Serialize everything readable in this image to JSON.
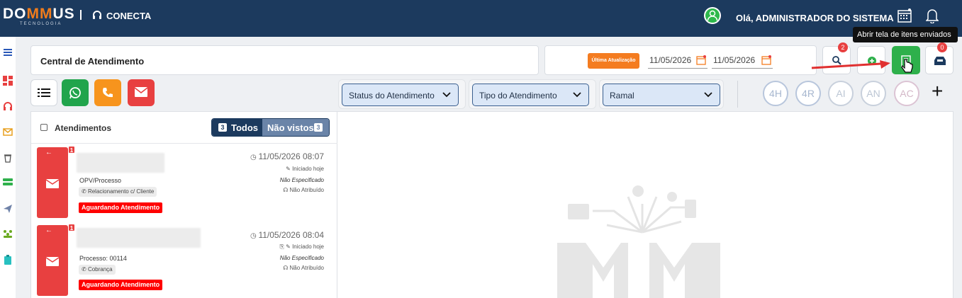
{
  "topbar": {
    "logo_text": "DOMMUS",
    "logo_prefix": "DO",
    "logo_mm": "MM",
    "logo_suffix": "US",
    "logo_sub": "TECNOLOGIA",
    "module": "CONECTA",
    "greeting": "Olá, ADMINISTRADOR DO SISTEMA"
  },
  "tooltip": "Abrir tela de itens enviados",
  "header": {
    "title": "Central de Atendimento",
    "update_badge": "Última Atualização",
    "date_start": "11/05/2026",
    "date_end": "11/05/2026",
    "search_count": "2",
    "inbox_count": "0"
  },
  "filters": {
    "status": "Status do Atendimento",
    "tipo": "Tipo do Atendimento",
    "ramal": "Ramal"
  },
  "queues": [
    "4H",
    "4R",
    "AI",
    "AN",
    "AC"
  ],
  "list": {
    "title": "Atendimentos",
    "tab_all": "Todos",
    "tab_all_count": "3",
    "tab_unseen": "Não vistos",
    "tab_unseen_count": "3",
    "items": [
      {
        "badge": "1",
        "process": "OPV/Processo",
        "tag": "Relacionamento c/ Cliente",
        "status": "Aguardando Atendimento",
        "datetime": "11/05/2026 08:07",
        "started": "Iniciado hoje",
        "assignment": "Não Especificado",
        "attendant": "Não Atribuído"
      },
      {
        "badge": "1",
        "process": "Processo: 00114",
        "tag": "Cobrança",
        "status": "Aguardando Atendimento",
        "datetime": "11/05/2026 08:04",
        "started": "Iniciado hoje",
        "assignment": "Não Especificado",
        "attendant": "Não Atribuído"
      }
    ]
  },
  "colors": {
    "navy": "#1c3a5e",
    "accent_orange": "#f47c20",
    "green": "#2eb04b",
    "red": "#e84040"
  }
}
